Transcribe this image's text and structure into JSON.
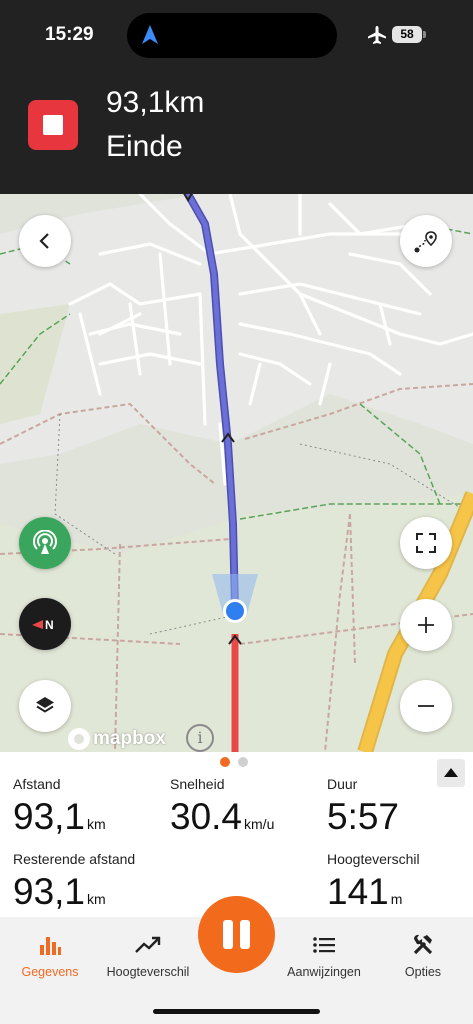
{
  "status_bar": {
    "time": "15:29",
    "battery": "58",
    "icons": [
      "location-arrow-icon",
      "airplane-icon",
      "battery-icon"
    ]
  },
  "navigation": {
    "distance": "93,1km",
    "instruction": "Einde",
    "stop_icon": "stop-icon",
    "stop_color": "#e8363f"
  },
  "map": {
    "attribution": "mapbox",
    "info": "i",
    "buttons": [
      "back-icon",
      "route-points-icon",
      "live-broadcast-icon",
      "compass-icon",
      "layers-icon",
      "fullscreen-icon",
      "zoom-in-icon",
      "zoom-out-icon"
    ],
    "route_color": "#5b5fc7",
    "track_color": "#e84848"
  },
  "stats": {
    "page_count": 2,
    "active_page": 1,
    "items": [
      {
        "label": "Afstand",
        "value": "93,1",
        "unit": "km"
      },
      {
        "label": "Snelheid",
        "value": "30.4",
        "unit": "km/u"
      },
      {
        "label": "Duur",
        "value": "5:57",
        "unit": ""
      },
      {
        "label": "Resterende afstand",
        "value": "93,1",
        "unit": "km"
      },
      {
        "label": "Hoogteverschil",
        "value": "141",
        "unit": "m"
      }
    ]
  },
  "tabs": [
    {
      "label": "Gegevens",
      "icon": "bar-chart-icon",
      "active": true
    },
    {
      "label": "Hoogteverschil",
      "icon": "trend-up-icon",
      "active": false
    },
    {
      "label": "Aanwijzingen",
      "icon": "list-icon",
      "active": false
    },
    {
      "label": "Opties",
      "icon": "tools-icon",
      "active": false
    }
  ],
  "accent_color": "#f26a1b"
}
